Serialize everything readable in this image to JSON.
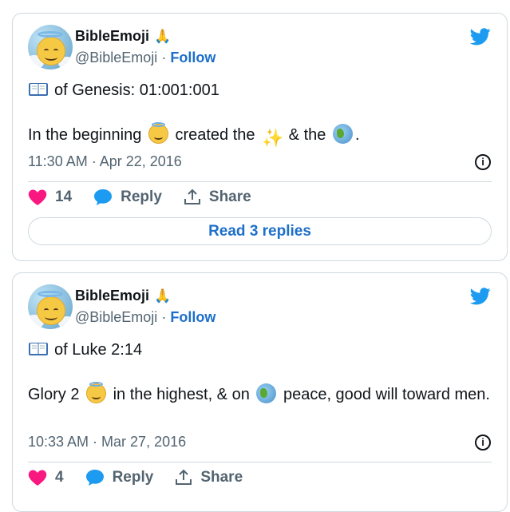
{
  "tweets": [
    {
      "display_name": "BibleEmoji",
      "handle": "@BibleEmoji",
      "separator": "·",
      "follow_label": "Follow",
      "line1": "of Genesis: 01:001:001",
      "line2_parts": [
        "In the beginning",
        "created the",
        "& the",
        "."
      ],
      "timestamp": "11:30 AM · Apr 22, 2016",
      "likes": "14",
      "reply_label": "Reply",
      "share_label": "Share",
      "read_replies_label": "Read 3 replies"
    },
    {
      "display_name": "BibleEmoji",
      "handle": "@BibleEmoji",
      "separator": "·",
      "follow_label": "Follow",
      "line1": "of Luke 2:14",
      "line2_parts": [
        "Glory 2",
        "in the highest, & on",
        "peace, good will toward men."
      ],
      "timestamp": "10:33 AM · Mar 27, 2016",
      "likes": "4",
      "reply_label": "Reply",
      "share_label": "Share"
    }
  ],
  "icons": {
    "verified_name_emoji": "folded-hands-icon",
    "book": "open-book-icon",
    "angel": "smiling-face-with-halo-icon",
    "sparkles": "sparkles-icon",
    "globe": "globe-icon",
    "twitter": "twitter-bird-icon",
    "info": "info-icon",
    "heart": "heart-icon",
    "reply": "speech-bubble-icon",
    "share": "share-icon"
  },
  "colors": {
    "accent": "#1d6fc9",
    "heart": "#f91880",
    "muted": "#536471",
    "border": "#cfd9de",
    "twitter_blue": "#1d9bf0"
  }
}
